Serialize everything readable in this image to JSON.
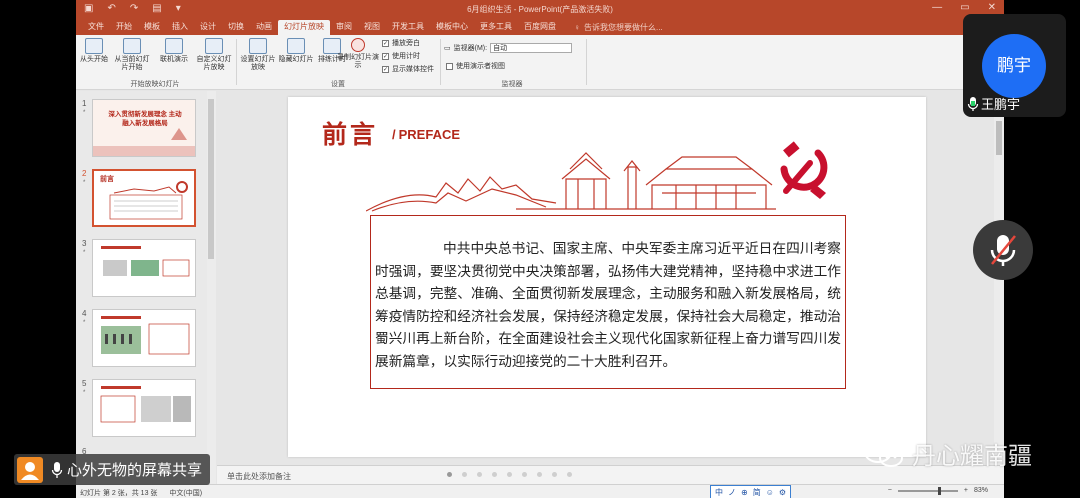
{
  "window": {
    "title": "6月组织生活 - PowerPoint(产品激活失败)",
    "quick_access": [
      "▣",
      "↶",
      "↷",
      "▤",
      "▾"
    ],
    "controls": [
      "—",
      "▭",
      "✕"
    ]
  },
  "ribbon": {
    "tabs": [
      "文件",
      "开始",
      "模板",
      "插入",
      "设计",
      "切换",
      "动画",
      "幻灯片放映",
      "审阅",
      "视图",
      "开发工具",
      "模板中心",
      "更多工具",
      "百度网盘"
    ],
    "active_tab": "幻灯片放映",
    "tell_me": "告诉我您想要做什么...",
    "buttons": [
      {
        "label": "从头开始"
      },
      {
        "label": "从当前幻灯片开始"
      },
      {
        "label": "联机演示"
      },
      {
        "label": "自定义幻灯片放映"
      },
      {
        "label": "设置幻灯片放映"
      },
      {
        "label": "隐藏幻灯片"
      },
      {
        "label": "排练计时"
      },
      {
        "label": "录制幻灯片演示"
      }
    ],
    "checkboxes": [
      "播放旁白",
      "使用计时",
      "显示媒体控件"
    ],
    "monitor_label": "监视器(M):",
    "monitor_value": "自动",
    "presenter_view": "使用演示者视图",
    "groups": [
      "开始放映幻灯片",
      "设置",
      "监视器"
    ]
  },
  "thumbnails": {
    "numbers": [
      "1",
      "2",
      "3",
      "4",
      "5",
      "6"
    ],
    "star": "*",
    "slide1_title": "深入贯彻新发展理念 主动融入新发展格局",
    "selected": "2"
  },
  "slide": {
    "title": "前言",
    "subtitle_slash": "/",
    "subtitle": "PREFACE",
    "body": "中共中央总书记、国家主席、中央军委主席习近平近日在四川考察时强调，要坚决贯彻党中央决策部署，弘扬伟大建党精神，坚持稳中求进工作总基调，完整、准确、全面贯彻新发展理念，主动服务和融入新发展格局，统筹疫情防控和经济社会发展，保持经济稳定发展，保持社会大局稳定，推动治蜀兴川再上新台阶，在全面建设社会主义现代化国家新征程上奋力谱写四川发展新篇章，以实际行动迎接党的二十大胜利召开。"
  },
  "notes_placeholder": "单击此处添加备注",
  "status": {
    "slide_info": "幻灯片 第 2 张，共 13 张",
    "language": "中文(中国)",
    "ime": [
      "中",
      "ノ",
      "⊕",
      "简",
      "☺",
      "⚙"
    ],
    "zoom": "83%"
  },
  "meeting": {
    "avatar_text": "鹏宇",
    "participant_name": "王鹏宇",
    "share_banner": "心外无物的屏幕共享",
    "colors": {
      "avatar": "#1e6ef5",
      "banner_icon": "#f08a24"
    }
  },
  "watermark": "丹心耀南疆",
  "colors": {
    "ppt_accent": "#b7472a",
    "slide_red": "#b3281b"
  }
}
